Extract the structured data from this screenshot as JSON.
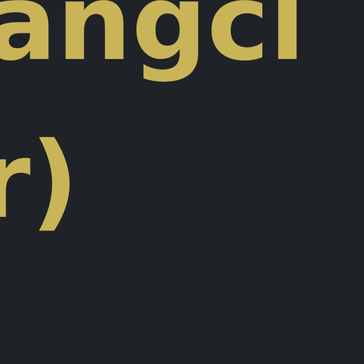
{
  "theme": {
    "background": "#1f2328",
    "text_color": "#c9b458"
  },
  "editor": {
    "lines": [
      "angcl",
      "r)"
    ]
  }
}
